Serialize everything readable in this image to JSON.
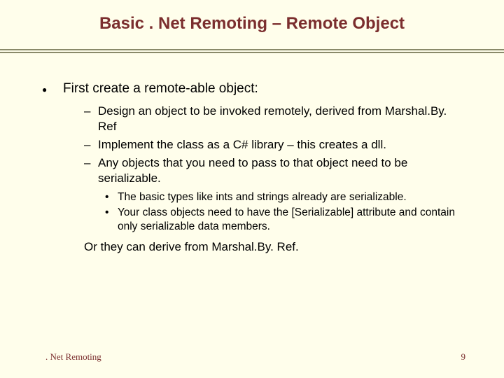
{
  "title": "Basic . Net Remoting – Remote Object",
  "l1": "First create a remote-able object:",
  "l2a": "Design an object to be invoked remotely, derived from Marshal.By. Ref",
  "l2b": "Implement the class as a C# library – this creates a dll.",
  "l2c": "Any objects that you need to pass to that object need to be serializable.",
  "l3a": "The basic types like ints and strings already are serializable.",
  "l3b": "Your class objects need to have the [Serializable] attribute and contain only serializable data members.",
  "orline": "Or they can derive from Marshal.By. Ref.",
  "footer_left": ". Net Remoting",
  "footer_right": "9"
}
